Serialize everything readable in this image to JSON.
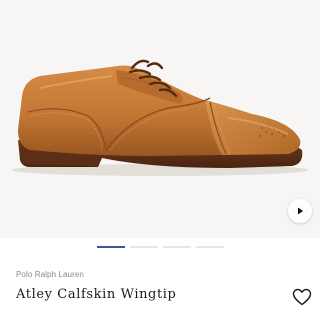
{
  "product": {
    "brand": "Polo Ralph Lauren",
    "name": "Atley Calfskin Wingtip"
  },
  "gallery": {
    "slide_count": 4,
    "active_slide": 1
  },
  "colors": {
    "active_dot": "#2e5d9a",
    "inactive_dot": "#e3e6ea",
    "leather": "#c47a34"
  },
  "icons": {
    "play": "play-icon",
    "wishlist": "heart-outline-icon"
  }
}
